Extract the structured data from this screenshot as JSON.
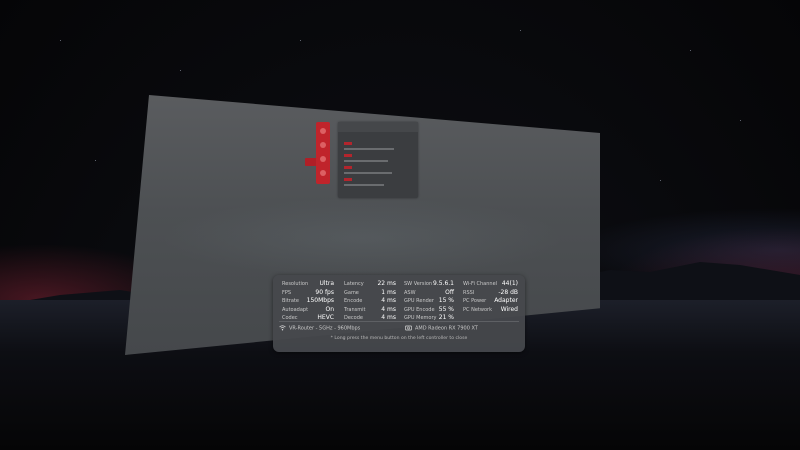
{
  "overlay": {
    "col1": [
      {
        "label": "Resolution",
        "value": "Ultra"
      },
      {
        "label": "FPS",
        "value": "90 fps"
      },
      {
        "label": "Bitrate",
        "value": "150Mbps"
      },
      {
        "label": "Autoadapt",
        "value": "On"
      },
      {
        "label": "Codec",
        "value": "HEVC"
      }
    ],
    "col2": [
      {
        "label": "Latency",
        "value": "22 ms"
      },
      {
        "label": "Game",
        "value": "1 ms"
      },
      {
        "label": "Encode",
        "value": "4 ms"
      },
      {
        "label": "Transmit",
        "value": "4 ms"
      },
      {
        "label": "Decode",
        "value": "4 ms"
      }
    ],
    "col3": [
      {
        "label": "SW Version",
        "value": "9.5.6.1"
      },
      {
        "label": "ASW",
        "value": "Off"
      },
      {
        "label": "GPU Render",
        "value": "15 %"
      },
      {
        "label": "GPU Encode",
        "value": "55 %"
      },
      {
        "label": "GPU Memory",
        "value": "21 %"
      }
    ],
    "col4": [
      {
        "label": "Wi-Fi Channel",
        "value": "44(1)"
      },
      {
        "label": "RSSI",
        "value": "-28 dB"
      },
      {
        "label": "PC Power",
        "value": "Adapter"
      },
      {
        "label": "PC Network",
        "value": "Wired"
      }
    ],
    "wifi": "VR-Router - 5GHz - 960Mbps",
    "gpu": "AMD Radeon RX 7900 XT",
    "hint": "* Long press the menu button on the left controller to close"
  },
  "icons": {
    "wifi": "wifi-icon",
    "gpu": "gpu-icon"
  },
  "colors": {
    "accent": "#c0242b",
    "overlay_bg": "#46484c"
  }
}
